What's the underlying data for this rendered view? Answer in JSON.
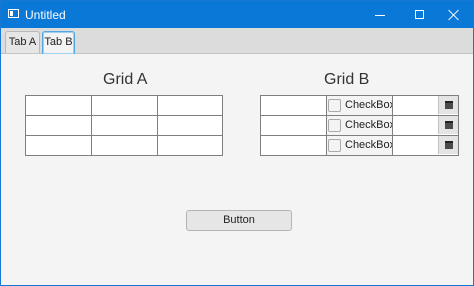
{
  "window": {
    "title": "Untitled"
  },
  "tabs": [
    {
      "label": "Tab A"
    },
    {
      "label": "Tab B"
    }
  ],
  "active_tab": "Tab B",
  "grid_a": {
    "title": "Grid A",
    "rows": 3,
    "columns": 3
  },
  "grid_b": {
    "title": "Grid B",
    "rows": [
      {
        "checkbox_label": "CheckBox",
        "checked": false
      },
      {
        "checkbox_label": "CheckBox",
        "checked": false
      },
      {
        "checkbox_label": "CheckBox",
        "checked": false
      }
    ]
  },
  "button": {
    "label": "Button"
  },
  "icons": {
    "app": "window-icon",
    "minimize": "minimize-icon",
    "maximize": "maximize-icon",
    "close": "close-icon",
    "date_picker": "calendar-icon"
  },
  "colors": {
    "titlebar": "#0a78d7",
    "active_tab_border": "#54a6e0",
    "background": "#f4f4f4"
  }
}
